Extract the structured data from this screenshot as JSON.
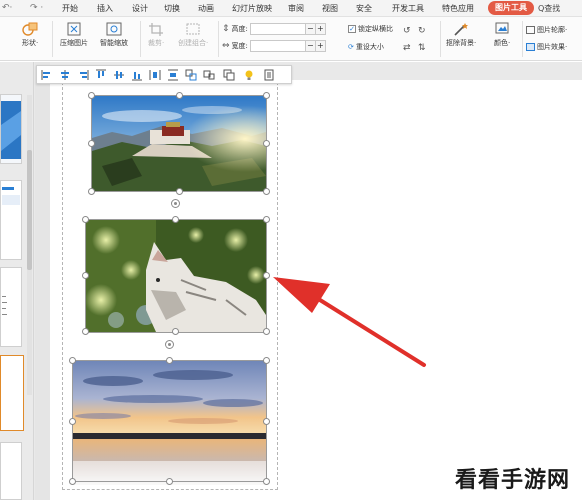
{
  "menu": {
    "tabs": [
      {
        "label": "开始",
        "active": false
      },
      {
        "label": "插入",
        "active": false
      },
      {
        "label": "设计",
        "active": false
      },
      {
        "label": "切换",
        "active": false
      },
      {
        "label": "动画",
        "active": false
      },
      {
        "label": "幻灯片放映",
        "active": false
      },
      {
        "label": "审阅",
        "active": false
      },
      {
        "label": "视图",
        "active": false
      },
      {
        "label": "安全",
        "active": false
      },
      {
        "label": "开发工具",
        "active": false
      },
      {
        "label": "特色应用",
        "active": false
      },
      {
        "label": "图片工具",
        "active": true
      }
    ],
    "search_label": "Q查找",
    "accent_color": "#e35a44"
  },
  "ribbon": {
    "shape_label": "形状·",
    "compress_label": "压缩图片",
    "smart_zoom_label": "智能缩放",
    "crop_label": "裁剪·",
    "create_combo_label": "创建组合·",
    "height_label": "高度:",
    "width_label": "宽度:",
    "lock_ratio_label": "锁定纵横比",
    "reset_size_label": "重设大小",
    "remove_bg_label": "抠除背景·",
    "color_label": "颜色·",
    "picture_outline_label": "图片轮廓·",
    "picture_effect_label": "图片效果·",
    "height_value": "",
    "width_value": ""
  },
  "image_toolbar": {
    "icons": [
      "align-left-icon",
      "align-center-icon",
      "align-right-icon",
      "align-top-icon",
      "align-middle-icon",
      "align-bottom-icon",
      "distribute-horizontal-icon",
      "distribute-vertical-icon",
      "group-icon",
      "ungroup-icon",
      "arrange-icon",
      "bulb-icon",
      "more-icon"
    ]
  },
  "slide": {
    "images": [
      "palace-landscape",
      "cat-photo",
      "sunset-lake"
    ]
  },
  "watermark": "看看手游网"
}
